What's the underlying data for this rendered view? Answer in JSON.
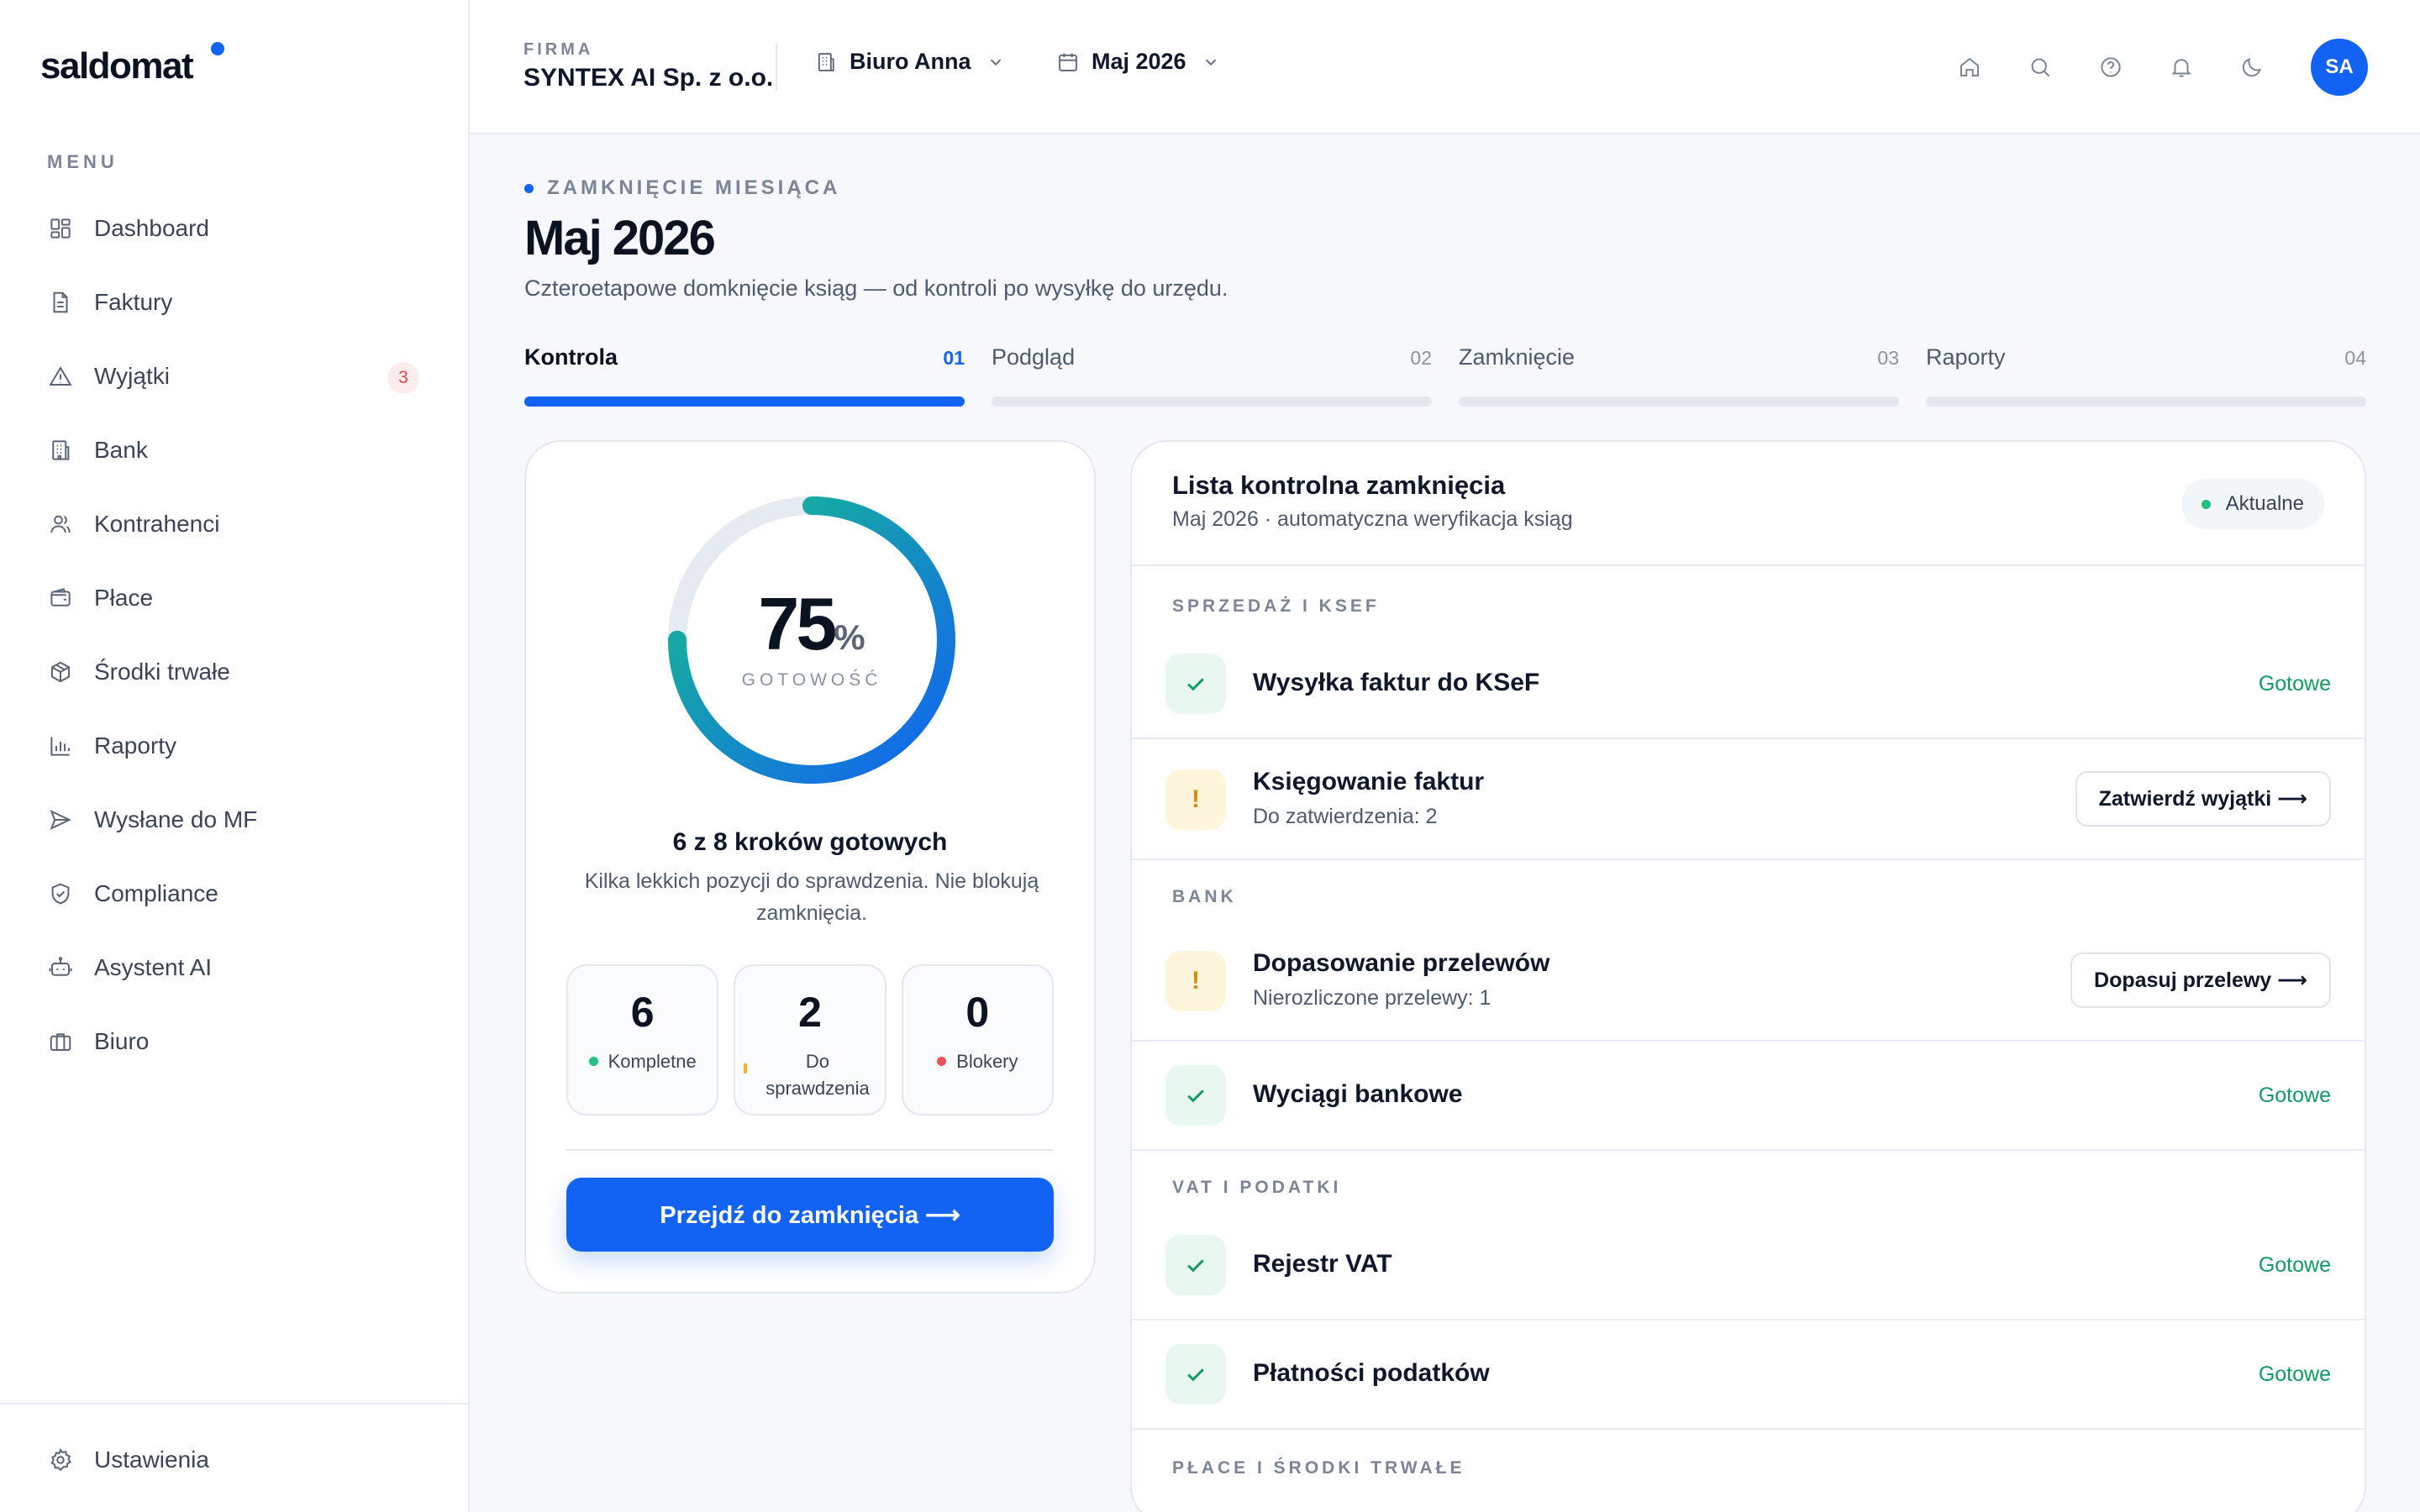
{
  "app": {
    "logo": "saldomat",
    "accent": "#1262f3"
  },
  "sidebar": {
    "menu_label": "MENU",
    "items": [
      {
        "label": "Dashboard",
        "icon": "dashboard-icon"
      },
      {
        "label": "Faktury",
        "icon": "document-icon"
      },
      {
        "label": "Wyjątki",
        "icon": "warning-icon",
        "badge": "3"
      },
      {
        "label": "Bank",
        "icon": "bank-icon"
      },
      {
        "label": "Kontrahenci",
        "icon": "users-icon"
      },
      {
        "label": "Płace",
        "icon": "wallet-icon"
      },
      {
        "label": "Środki trwałe",
        "icon": "box-icon"
      },
      {
        "label": "Raporty",
        "icon": "chart-icon"
      },
      {
        "label": "Wysłane do MF",
        "icon": "send-icon"
      },
      {
        "label": "Compliance",
        "icon": "shield-icon"
      },
      {
        "label": "Asystent AI",
        "icon": "robot-icon"
      },
      {
        "label": "Biuro",
        "icon": "briefcase-icon"
      }
    ],
    "settings_label": "Ustawienia"
  },
  "header": {
    "firm_label": "FIRMA",
    "firm_name": "SYNTEX AI Sp. z o.o.",
    "office": "Biuro Anna",
    "period": "Maj 2026",
    "avatar": "SA"
  },
  "page": {
    "eyebrow": "ZAMKNIĘCIE MIESIĄCA",
    "title": "Maj 2026",
    "subtitle": "Czteroetapowe domknięcie ksiąg — od kontroli po wysyłkę do urzędu."
  },
  "steps": [
    {
      "name": "Kontrola",
      "num": "01",
      "active": true
    },
    {
      "name": "Podgląd",
      "num": "02",
      "active": false
    },
    {
      "name": "Zamknięcie",
      "num": "03",
      "active": false
    },
    {
      "name": "Raporty",
      "num": "04",
      "active": false
    }
  ],
  "progress": {
    "percent": 75,
    "percent_text": "75",
    "percent_symbol": "%",
    "label": "GOTOWOŚĆ",
    "title": "6 z 8 kroków gotowych",
    "subtitle": "Kilka lekkich pozycji do sprawdzenia. Nie blokują zamknięcia.",
    "stats": [
      {
        "value": "6",
        "label": "Kompletne",
        "color": "#21c27f"
      },
      {
        "value": "2",
        "label": "Do sprawdzenia",
        "color": "#f5b324"
      },
      {
        "value": "0",
        "label": "Blokery",
        "color": "#f0505a"
      }
    ],
    "cta": "Przejdź do zamknięcia ⟶"
  },
  "checklist": {
    "title": "Lista kontrolna zamknięcia",
    "subtitle": "Maj 2026 · automatyczna weryfikacja ksiąg",
    "status_pill": "Aktualne",
    "sections": [
      {
        "label": "SPRZEDAŻ I KSEF"
      },
      {
        "label": "BANK"
      },
      {
        "label": "VAT I PODATKI"
      },
      {
        "label": "PŁACE I ŚRODKI TRWAŁE"
      }
    ],
    "rows": [
      {
        "title": "Wysyłka faktur do KSeF",
        "status": "Gotowe",
        "state": "ok"
      },
      {
        "title": "Księgowanie faktur",
        "sub": "Do zatwierdzenia: 2",
        "action": "Zatwierdź wyjątki ⟶",
        "state": "warn"
      },
      {
        "title": "Dopasowanie przelewów",
        "sub": "Nierozliczone przelewy: 1",
        "action": "Dopasuj przelewy ⟶",
        "state": "warn"
      },
      {
        "title": "Wyciągi bankowe",
        "status": "Gotowe",
        "state": "ok"
      },
      {
        "title": "Rejestr VAT",
        "status": "Gotowe",
        "state": "ok"
      },
      {
        "title": "Płatności podatków",
        "status": "Gotowe",
        "state": "ok"
      }
    ]
  }
}
